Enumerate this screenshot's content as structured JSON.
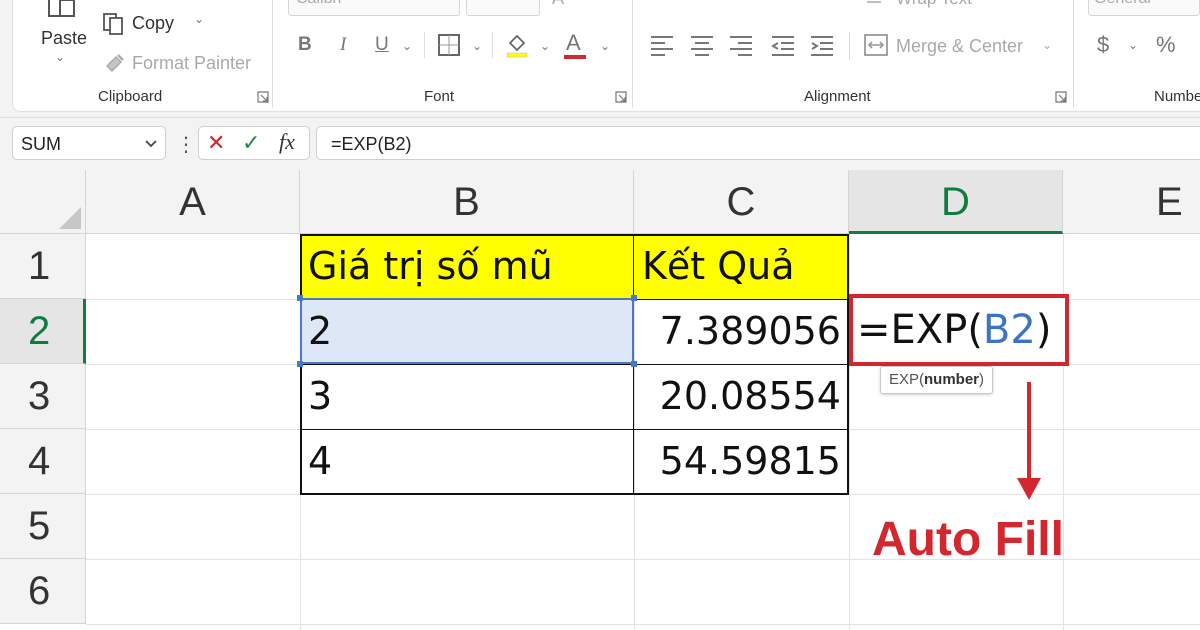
{
  "ribbon": {
    "clipboard": {
      "label": "Clipboard",
      "paste_label": "Paste",
      "paste_caret": "⌄",
      "copy_label": "Copy",
      "copy_caret": "⌄",
      "format_painter_label": "Format Painter"
    },
    "font": {
      "label": "Font",
      "font_name": "Calibri",
      "bold": "B",
      "italic": "I",
      "underline": "U",
      "font_color_letter": "A",
      "grow_font_letter": "A"
    },
    "alignment": {
      "label": "Alignment",
      "wrap_text_label": "Wrap Text",
      "merge_center_label": "Merge & Center"
    },
    "number": {
      "label": "Numbe",
      "format": "General",
      "currency": "$",
      "percent": "%"
    }
  },
  "formula_bar": {
    "name_box": "SUM",
    "separator": "⋮",
    "cancel_symbol": "✕",
    "enter_symbol": "✓",
    "fx_label": "fx",
    "formula": "=EXP(B2)"
  },
  "grid": {
    "columns": [
      "A",
      "B",
      "C",
      "D",
      "E"
    ],
    "rows": [
      "1",
      "2",
      "3",
      "4",
      "5",
      "6"
    ],
    "selected_column": "D",
    "selected_row": "2",
    "header_b": "Giá trị số mũ",
    "header_c": "Kết Quả",
    "b_values": [
      "2",
      "3",
      "4"
    ],
    "c_values": [
      "7.389056",
      "20.08554",
      "54.59815"
    ]
  },
  "edit_cell": {
    "prefix": "=EXP(",
    "ref": "B2",
    "suffix": ")"
  },
  "tooltip": {
    "func": "EXP(",
    "arg": "number",
    "close": ")"
  },
  "annotation": {
    "text": "Auto Fill",
    "color": "#d2272e"
  },
  "colors": {
    "header_fill": "#ffff00",
    "excel_green": "#107c41",
    "selection_blue": "#4a78c2",
    "reference_blue": "#3d73c4"
  }
}
